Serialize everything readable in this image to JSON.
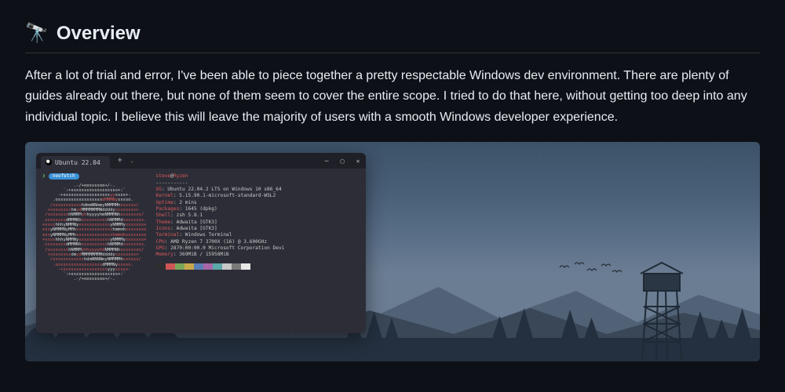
{
  "heading": {
    "emoji": "🔭",
    "title": "Overview"
  },
  "intro": "After a lot of trial and error, I've been able to piece together a pretty respectable Windows dev environment. There are plenty of guides already out there, but none of them seem to cover the entire scope. I tried to do that here, without getting too deep into any individual topic. I believe this will leave the majority of users with a smooth Windows developer experience.",
  "terminal": {
    "tab_label": "Ubuntu 22.04",
    "plus": "+",
    "caret": "⌄",
    "minimize": "─",
    "maximize": "▢",
    "close": "✕",
    "prompt_cmd": "neofetch",
    "user": "steve",
    "host": "Ryzen",
    "dashes": "-----------",
    "info": [
      {
        "key": "OS",
        "val": "Ubuntu 22.04.2 LTS on Windows 10 x86_64"
      },
      {
        "key": "Kernel",
        "val": "5.15.90.1-microsoft-standard-WSL2"
      },
      {
        "key": "Uptime",
        "val": "2 mins"
      },
      {
        "key": "Packages",
        "val": "1645 (dpkg)"
      },
      {
        "key": "Shell",
        "val": "zsh 5.8.1"
      },
      {
        "key": "Theme",
        "val": "Adwaita [GTK3]"
      },
      {
        "key": "Icons",
        "val": "Adwaita [GTK3]"
      },
      {
        "key": "Terminal",
        "val": "Windows Terminal"
      },
      {
        "key": "CPU",
        "val": "AMD Ryzen 7 3700X (16) @ 3.600GHz"
      },
      {
        "key": "GPU",
        "val": "2870:00:00.0 Microsoft Corporation Devi"
      },
      {
        "key": "Memory",
        "val": "369MiB / 15958MiB"
      }
    ],
    "swatches": [
      "#2e2e2e",
      "#cc5555",
      "#7aa65a",
      "#c9a84c",
      "#5a7fb5",
      "#a866a8",
      "#5aa8a8",
      "#c8c8c8",
      "#7a7a7a",
      "#e8e8e8"
    ]
  }
}
